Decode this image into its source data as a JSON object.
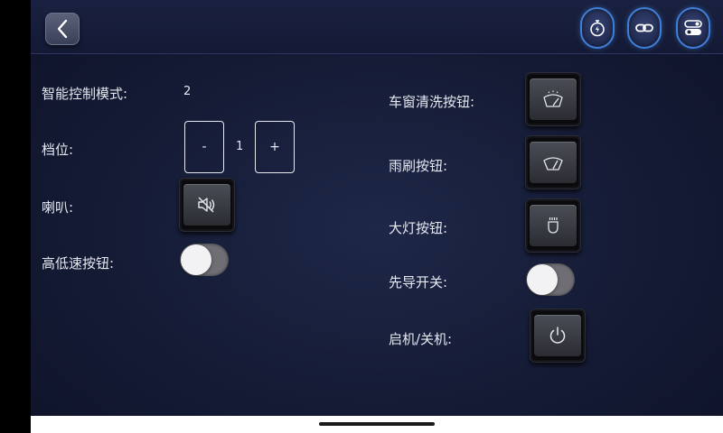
{
  "topbar": {
    "back_icon": "chevron-left-icon",
    "icons": [
      "engine-timer-icon",
      "link-icon",
      "toggle-settings-icon"
    ]
  },
  "controls": {
    "smart_mode": {
      "label": "智能控制模式:",
      "value": "2"
    },
    "gear": {
      "label": "档位:",
      "minus": "-",
      "value": "1",
      "plus": "+"
    },
    "horn": {
      "label": "喇叭:",
      "icon": "speaker-mute-icon"
    },
    "high_low_speed": {
      "label": "高低速按钮:",
      "state": "off"
    },
    "window_wash": {
      "label": "车窗清洗按钮:",
      "icon": "windshield-washer-icon"
    },
    "wiper": {
      "label": "雨刷按钮:",
      "icon": "wiper-icon"
    },
    "headlight": {
      "label": "大灯按钮:",
      "icon": "headlight-icon"
    },
    "pilot_switch": {
      "label": "先导开关:",
      "state": "off"
    },
    "power": {
      "label": "启机/关机:",
      "icon": "power-icon"
    }
  },
  "colors": {
    "accent": "#3f7fd8",
    "background": "#151b35",
    "toggle_off": "#6e6e74"
  }
}
